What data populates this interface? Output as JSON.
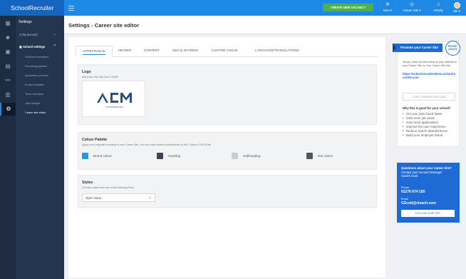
{
  "app": {
    "name": "SchoolRecruiter"
  },
  "topbar": {
    "create_label": "CREATE NEW VACANCY",
    "nav": [
      {
        "label": "New ▾",
        "icon": "plus-circle-icon"
      },
      {
        "label": "Career Site ▾",
        "icon": "globe-icon"
      },
      {
        "label": "Activity",
        "icon": "bell-icon"
      },
      {
        "label": "Me ▾",
        "icon": "avatar"
      }
    ]
  },
  "sidebar": {
    "title": "Settings",
    "sections": [
      {
        "label": "My account",
        "icon": "person-icon",
        "chevron": "⌄"
      },
      {
        "label": "School settings",
        "icon": "building-icon",
        "chevron": "⌃"
      }
    ],
    "items": [
      "General information",
      "Recruiting pipeline",
      "Application preview",
      "Email templates",
      "Team members",
      "Jobs Widget",
      "Career site editor"
    ],
    "active_item": "Career site editor"
  },
  "page": {
    "title": "Settings - Career site editor"
  },
  "tabs": [
    "APPEARANCE",
    "HEADER",
    "CONTENT",
    "SEO & SHARING",
    "CUSTOM CSS/JS",
    "LANGUAGE/TRANSLATIONS"
  ],
  "active_tab": "APPEARANCE",
  "logo_section": {
    "label": "Logo",
    "hint": "Maximum File Size limit: 100KB",
    "logo_text": "ACM",
    "logo_caption": "SCHOOLRECRUITER"
  },
  "palette": {
    "label": "Colour Palette",
    "hint": "Apply your corporate branding to your Career Site. You can make further modifications on the Custom CSS/JS tab.",
    "swatches": [
      {
        "label": "Brand colour",
        "color": "#1e9be6"
      },
      {
        "label": "Heading",
        "color": "#3b4654"
      },
      {
        "label": "Subheading",
        "color": "#c9ccd1"
      },
      {
        "label": "text colour",
        "color": "#4f565d"
      }
    ]
  },
  "styles": {
    "label": "Styles",
    "hint": "Choose a style from one of the following fonts.",
    "selected": "Open Sans"
  },
  "promo": {
    "title": "Promote your Career Site",
    "badge_line1": "EXPERT",
    "badge_line2": "ADVICE",
    "description": "Simply, place the link below on your website to your Career Site on Your Career Site link:",
    "link": "https://schoolrecruiterdemo.schoolrecruiter.com",
    "copy_label": "COPY CAREER SITE LINK",
    "why_title": "Why this is good for your school?",
    "benefits": [
      "Get your jobs found faster",
      "Gain more job views",
      "Gain more applications",
      "Improve the user experience",
      "Reduce search abandonment",
      "Build your employer brand"
    ]
  },
  "contact": {
    "question": "Questions about your Career Site?",
    "line1": "Contact your Account Manager",
    "line2": "Gareth Scott",
    "phone_label": "Phone",
    "phone": "01276 674 165",
    "email_label": "Email",
    "email": "GScott@eteach.com",
    "button": "FOLLOW OUR TIPS"
  },
  "colors": {
    "accent": "#1e88e5",
    "cta": "#4caf50",
    "sidebar": "#243550"
  }
}
